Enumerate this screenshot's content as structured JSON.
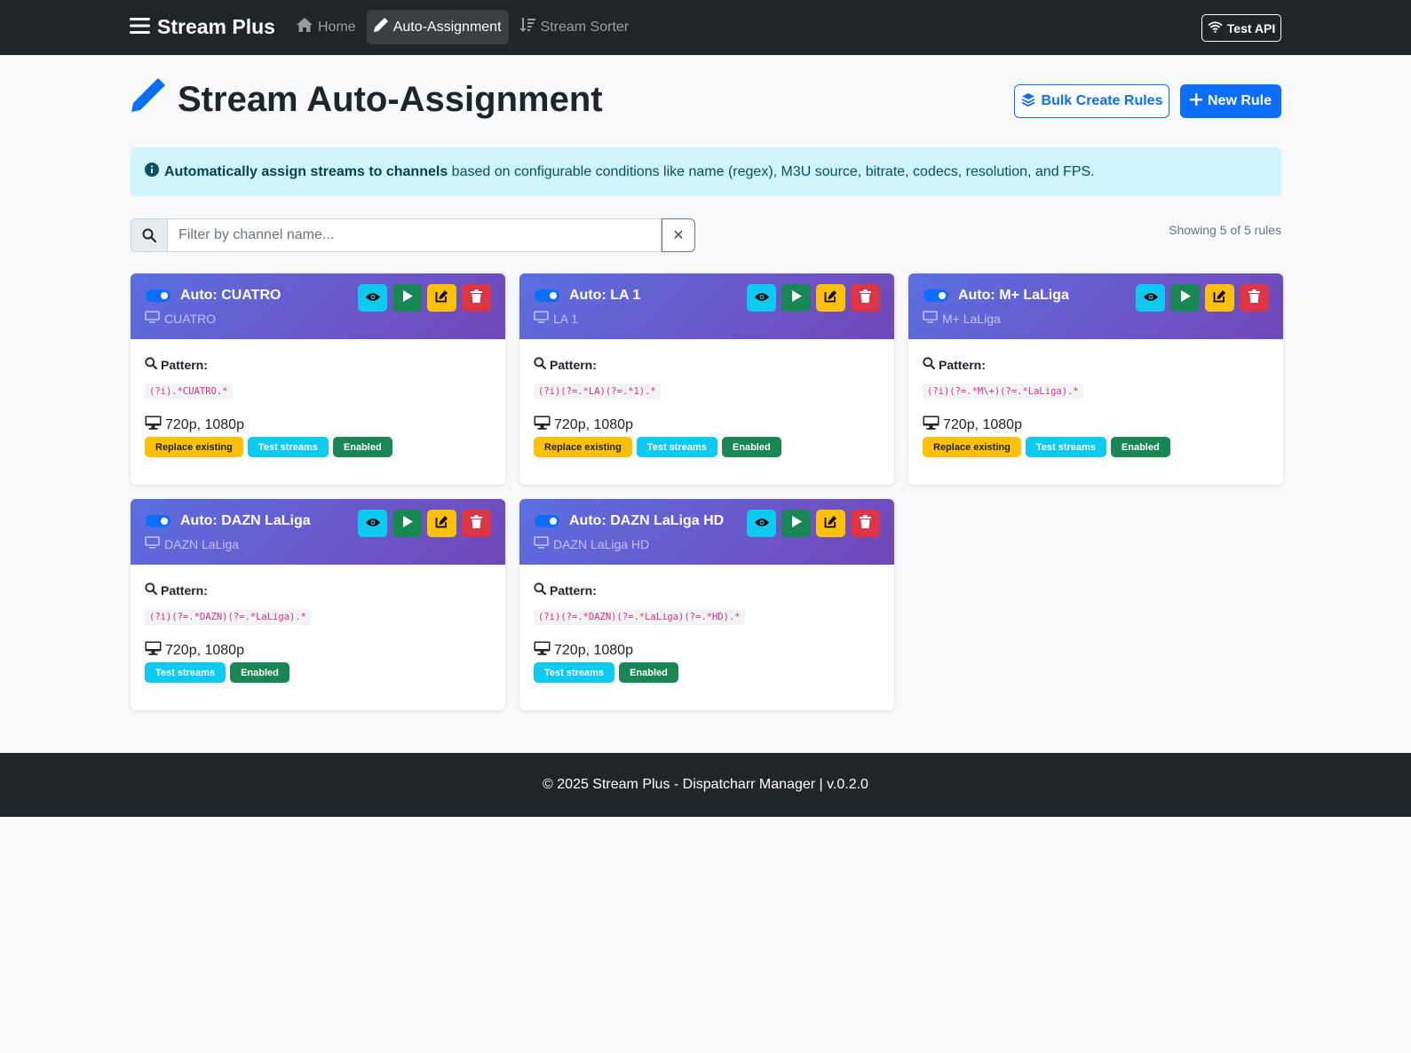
{
  "nav": {
    "brand": "Stream Plus",
    "links": [
      {
        "label": "Home",
        "active": false
      },
      {
        "label": "Auto-Assignment",
        "active": true
      },
      {
        "label": "Stream Sorter",
        "active": false
      }
    ],
    "test_api": "Test API"
  },
  "header": {
    "title": "Stream Auto-Assignment",
    "bulk_label": "Bulk Create Rules",
    "new_label": "New Rule"
  },
  "alert": {
    "bold": "Automatically assign streams to channels",
    "text": " based on configurable conditions like name (regex), M3U source, bitrate, codecs, resolution, and FPS."
  },
  "filter": {
    "placeholder": "Filter by channel name...",
    "clear": "✕",
    "showing": "Showing 5 of 5 rules"
  },
  "labels": {
    "pattern": "Pattern:"
  },
  "rules": [
    {
      "name": "Auto: CUATRO",
      "channel": "CUATRO",
      "pattern": "(?i).*CUATRO.*",
      "resolution": "720p, 1080p",
      "badges": {
        "replace": "Replace existing",
        "test": "Test streams",
        "enabled": "Enabled"
      }
    },
    {
      "name": "Auto: LA 1",
      "channel": "LA 1",
      "pattern": "(?i)(?=.*LA)(?=.*1).*",
      "resolution": "720p, 1080p",
      "badges": {
        "replace": "Replace existing",
        "test": "Test streams",
        "enabled": "Enabled"
      }
    },
    {
      "name": "Auto: M+ LaLiga",
      "channel": "M+ LaLiga",
      "pattern": "(?i)(?=.*M\\+)(?=.*LaLiga).*",
      "resolution": "720p, 1080p",
      "badges": {
        "replace": "Replace existing",
        "test": "Test streams",
        "enabled": "Enabled"
      }
    },
    {
      "name": "Auto: DAZN LaLiga",
      "channel": "DAZN LaLiga",
      "pattern": "(?i)(?=.*DAZN)(?=.*LaLiga).*",
      "resolution": "720p, 1080p",
      "badges": {
        "test": "Test streams",
        "enabled": "Enabled"
      }
    },
    {
      "name": "Auto: DAZN LaLiga HD",
      "channel": "DAZN LaLiga HD",
      "pattern": "(?i)(?=.*DAZN)(?=.*LaLiga)(?=.*HD).*",
      "resolution": "720p, 1080p",
      "badges": {
        "test": "Test streams",
        "enabled": "Enabled"
      }
    }
  ],
  "footer": {
    "text": "© 2025 Stream Plus - Dispatcharr Manager | v.0.2.0"
  },
  "colors": {
    "primary": "#0d6efd",
    "info": "#0dcaf0",
    "success": "#198754",
    "warning": "#ffc107",
    "danger": "#dc3545",
    "dark": "#212529"
  }
}
